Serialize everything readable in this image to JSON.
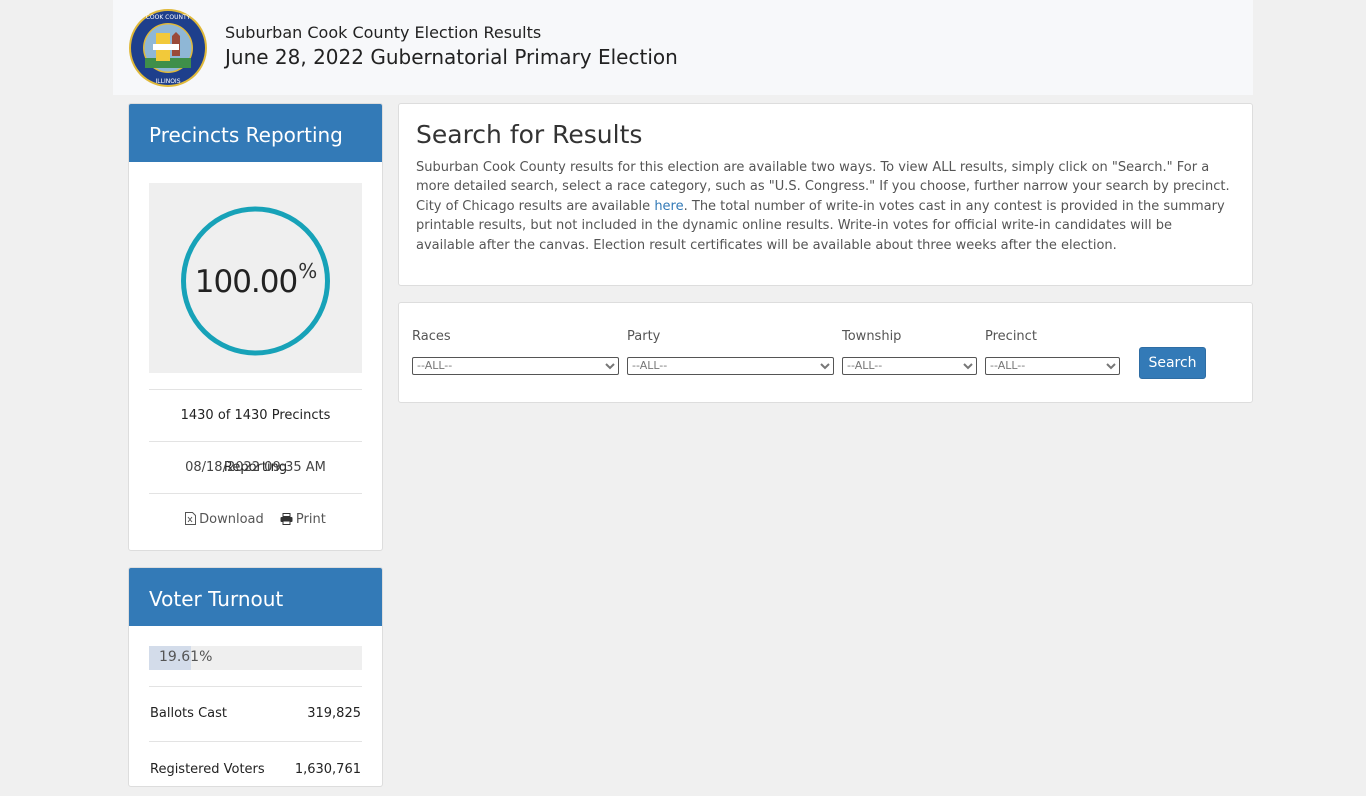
{
  "header": {
    "subtitle": "Suburban Cook County Election Results",
    "title": "June 28, 2022 Gubernatorial Primary Election",
    "seal_alt": "Seal of Cook County Illinois"
  },
  "precincts": {
    "heading": "Precincts Reporting",
    "percent_value": "100.00",
    "percent_sign": "%",
    "percent_fraction": 1.0,
    "count_text": "1430 of 1430 Precincts Reporting",
    "timestamp": "08/18/2022 09:35 AM",
    "download_label": "Download",
    "print_label": "Print",
    "gauge_color": "#17a2b8"
  },
  "turnout": {
    "heading": "Voter Turnout",
    "percent_text": "19.61%",
    "percent_fraction": 0.1961,
    "ballots_label": "Ballots Cast",
    "ballots_value": "319,825",
    "registered_label": "Registered Voters",
    "registered_value": "1,630,761"
  },
  "search": {
    "title": "Search for Results",
    "para1": "Suburban Cook County results for this election are available two ways. To view ALL results, simply click on \"Search.\" For a more detailed search, select a race category, such as \"U.S. Congress.\" If you choose, further narrow your search by precinct.",
    "para2_before": "City of Chicago results are available ",
    "para2_link": "here",
    "para2_after": ". The total number of write-in votes cast in any contest is provided in the summary printable results, but not included in the dynamic online results. Write-in votes for official write-in candidates will be available after the canvas. Election result certificates will be available about three weeks after the election."
  },
  "filters": {
    "races_label": "Races",
    "races_value": "--ALL--",
    "party_label": "Party",
    "party_value": "--ALL--",
    "township_label": "Township",
    "township_value": "--ALL--",
    "precinct_label": "Precinct",
    "precinct_value": "--ALL--",
    "search_button": "Search"
  },
  "colors": {
    "brand": "#337ab7",
    "gauge": "#17a2b8",
    "link": "#337ab7"
  }
}
